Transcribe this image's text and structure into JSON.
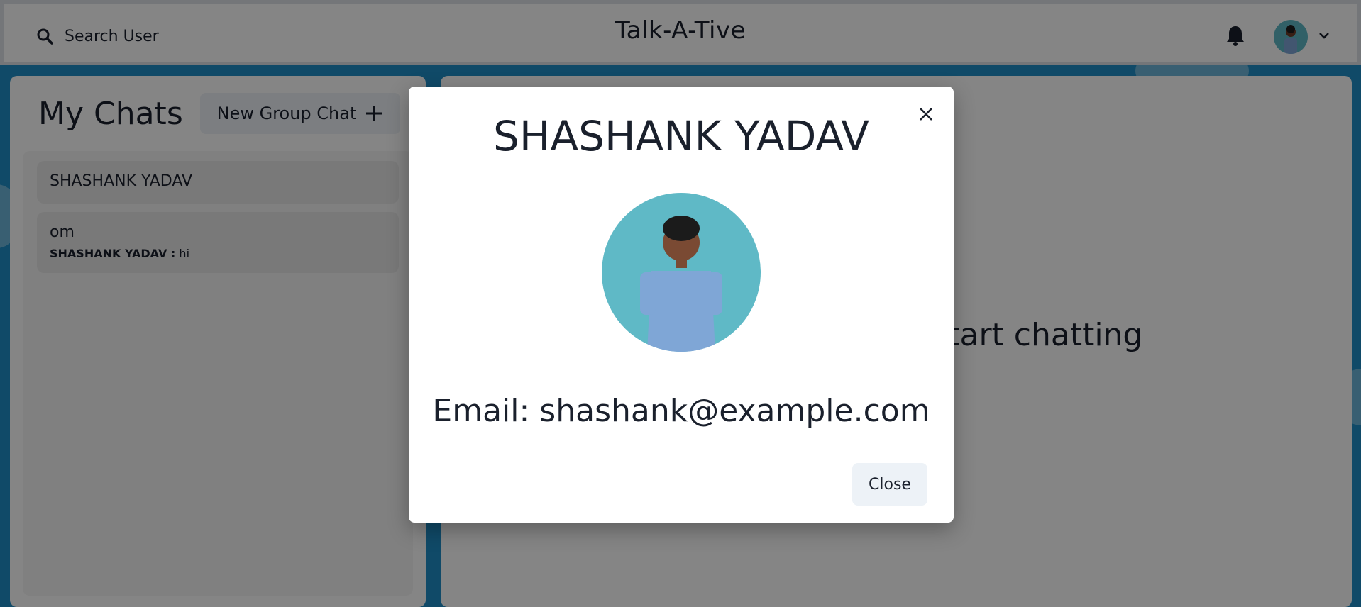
{
  "header": {
    "search_label": "Search User",
    "app_title": "Talk-A-Tive"
  },
  "sidebar": {
    "title": "My Chats",
    "new_group_label": "New Group Chat",
    "chats": [
      {
        "name": "SHASHANK YADAV"
      },
      {
        "name": "om",
        "latest_sender": "SHASHANK YADAV :",
        "latest_message": "hi"
      }
    ]
  },
  "main": {
    "hint_text": "Click on a user to start chatting"
  },
  "modal": {
    "title": "SHASHANK YADAV",
    "email_text": "Email: shashank@example.com",
    "close_label": "Close"
  },
  "icons": {
    "search": "search-icon",
    "bell": "bell-icon",
    "chevron": "chevron-down-icon",
    "plus": "plus-icon",
    "close": "close-icon"
  },
  "colors": {
    "background": "#1f8fc7",
    "text": "#1a202c",
    "button_bg": "#edf2f7"
  }
}
